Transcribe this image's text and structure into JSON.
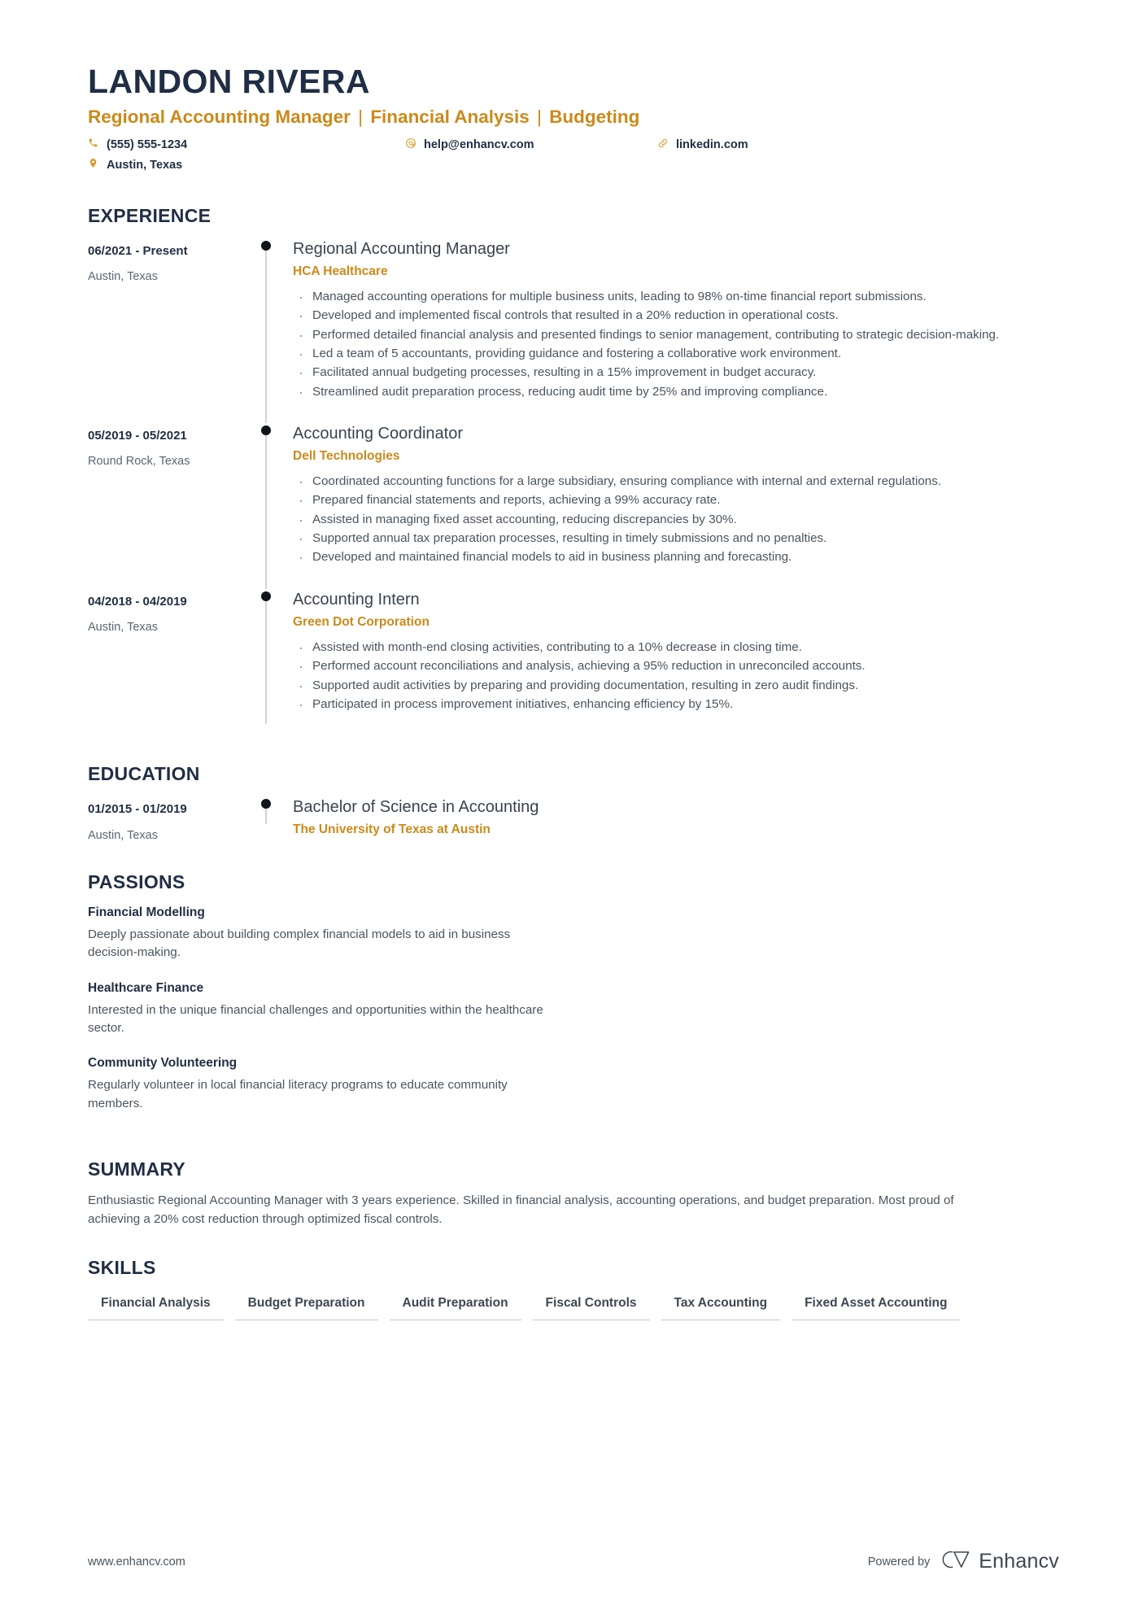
{
  "header": {
    "name": "LANDON RIVERA",
    "headline_parts": [
      "Regional Accounting Manager",
      "Financial Analysis",
      "Budgeting"
    ],
    "contacts": [
      {
        "icon": "phone-icon",
        "value": "(555) 555-1234"
      },
      {
        "icon": "email-icon",
        "value": "help@enhancv.com"
      },
      {
        "icon": "link-icon",
        "value": "linkedin.com"
      },
      {
        "icon": "location-pin-icon",
        "value": "Austin, Texas"
      }
    ]
  },
  "sections": {
    "experience_title": "EXPERIENCE",
    "education_title": "EDUCATION",
    "passions_title": "PASSIONS",
    "summary_title": "SUMMARY",
    "skills_title": "SKILLS"
  },
  "experience": [
    {
      "date": "06/2021 - Present",
      "location": "Austin, Texas",
      "title": "Regional Accounting Manager",
      "company": "HCA Healthcare",
      "bullets": [
        "Managed accounting operations for multiple business units, leading to 98% on-time financial report submissions.",
        "Developed and implemented fiscal controls that resulted in a 20% reduction in operational costs.",
        "Performed detailed financial analysis and presented findings to senior management, contributing to strategic decision-making.",
        "Led a team of 5 accountants, providing guidance and fostering a collaborative work environment.",
        "Facilitated annual budgeting processes, resulting in a 15% improvement in budget accuracy.",
        "Streamlined audit preparation process, reducing audit time by 25% and improving compliance."
      ]
    },
    {
      "date": "05/2019 - 05/2021",
      "location": "Round Rock, Texas",
      "title": "Accounting Coordinator",
      "company": "Dell Technologies",
      "bullets": [
        "Coordinated accounting functions for a large subsidiary, ensuring compliance with internal and external regulations.",
        "Prepared financial statements and reports, achieving a 99% accuracy rate.",
        "Assisted in managing fixed asset accounting, reducing discrepancies by 30%.",
        "Supported annual tax preparation processes, resulting in timely submissions and no penalties.",
        "Developed and maintained financial models to aid in business planning and forecasting."
      ]
    },
    {
      "date": "04/2018 - 04/2019",
      "location": "Austin, Texas",
      "title": "Accounting Intern",
      "company": "Green Dot Corporation",
      "bullets": [
        "Assisted with month-end closing activities, contributing to a 10% decrease in closing time.",
        "Performed account reconciliations and analysis, achieving a 95% reduction in unreconciled accounts.",
        "Supported audit activities by preparing and providing documentation, resulting in zero audit findings.",
        "Participated in process improvement initiatives, enhancing efficiency by 15%."
      ]
    }
  ],
  "education": [
    {
      "date": "01/2015 - 01/2019",
      "location": "Austin, Texas",
      "degree": "Bachelor of Science in Accounting",
      "school": "The University of Texas at Austin"
    }
  ],
  "passions": [
    {
      "title": "Financial Modelling",
      "description": "Deeply passionate about building complex financial models to aid in business decision-making."
    },
    {
      "title": "Healthcare Finance",
      "description": "Interested in the unique financial challenges and opportunities within the healthcare sector."
    },
    {
      "title": "Community Volunteering",
      "description": "Regularly volunteer in local financial literacy programs to educate community members."
    }
  ],
  "summary": {
    "text": "Enthusiastic Regional Accounting Manager with 3 years experience. Skilled in financial analysis, accounting operations, and budget preparation. Most proud of achieving a 20% cost reduction through optimized fiscal controls."
  },
  "skills": [
    "Financial Analysis",
    "Budget Preparation",
    "Audit Preparation",
    "Fiscal Controls",
    "Tax Accounting",
    "Fixed Asset Accounting"
  ],
  "footer": {
    "url": "www.enhancv.com",
    "powered_by": "Powered by",
    "brand": "Enhancv"
  },
  "colors": {
    "accent": "#cb8a1a",
    "dark": "#1f2e44",
    "body": "#4a545f",
    "rail": "#cfd4d9"
  }
}
